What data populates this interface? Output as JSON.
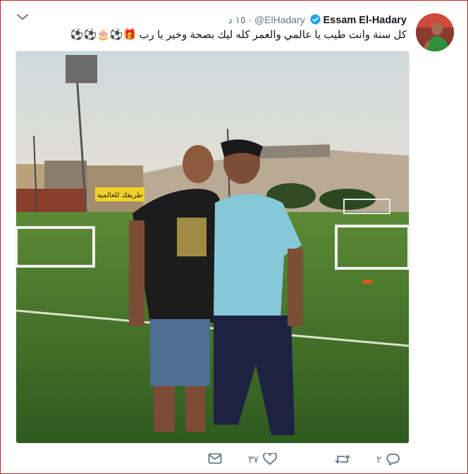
{
  "tweet": {
    "display_name": "Essam El-Hadary",
    "handle": "@ElHadary",
    "separator": "·",
    "time": "١٥ د",
    "text": "كل سنة وانت طيب يا عالمي والعمر كله ليك بصحة وخير يا رب 🎁⚽🎂⚽⚽",
    "photo_sign_text": "طريقك للعالمية"
  },
  "actions": {
    "reply_count": "٢",
    "retweet_count": "",
    "like_count": "٣٧"
  },
  "icons": {
    "menu": "chevron-down-icon",
    "verified": "verified-badge-icon",
    "reply": "reply-icon",
    "retweet": "retweet-icon",
    "like": "heart-icon",
    "dm": "envelope-icon"
  },
  "colors": {
    "border": "#c0262d",
    "verified": "#1da1f2",
    "text": "#14171a",
    "muted": "#657786"
  }
}
